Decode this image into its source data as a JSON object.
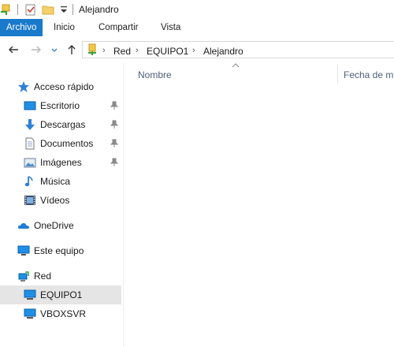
{
  "window": {
    "title": "Alejandro"
  },
  "ribbon": {
    "tabs": [
      {
        "label": "Archivo",
        "active": true
      },
      {
        "label": "Inicio",
        "active": false
      },
      {
        "label": "Compartir",
        "active": false
      },
      {
        "label": "Vista",
        "active": false
      }
    ]
  },
  "address": {
    "crumbs": [
      "Red",
      "EQUIPO1",
      "Alejandro"
    ]
  },
  "navpane": {
    "quick_access": "Acceso rápido",
    "quick_items": [
      "Escritorio",
      "Descargas",
      "Documentos",
      "Imágenes",
      "Música",
      "Vídeos"
    ],
    "onedrive": "OneDrive",
    "this_pc": "Este equipo",
    "network": "Red",
    "network_items": [
      "EQUIPO1",
      "VBOXSVR"
    ],
    "selected": "EQUIPO1"
  },
  "content": {
    "columns": [
      "Nombre",
      "Fecha de mo"
    ]
  },
  "colors": {
    "accent": "#1979ca",
    "selected_bg": "#e5e5e5",
    "header_text": "#4c607a"
  }
}
